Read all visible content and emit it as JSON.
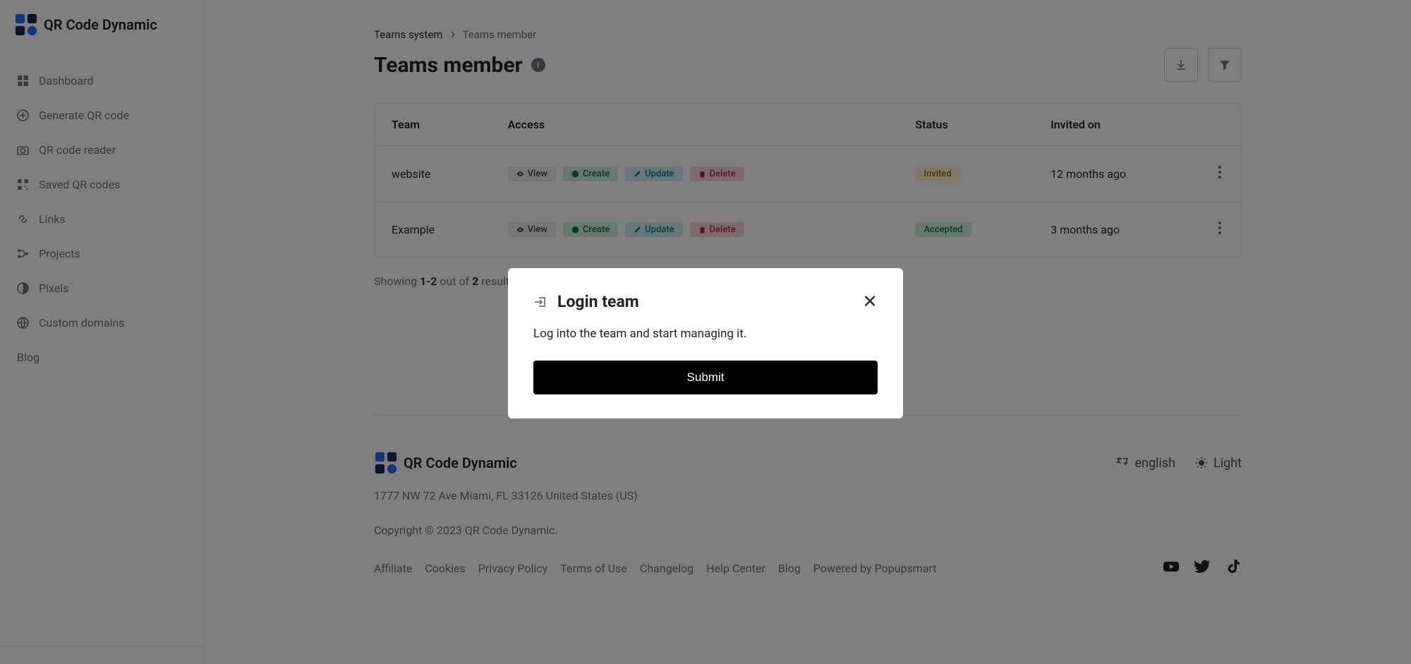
{
  "app": {
    "name": "QR Code Dynamic"
  },
  "sidebar": {
    "items": [
      {
        "label": "Dashboard"
      },
      {
        "label": "Generate QR code"
      },
      {
        "label": "QR code reader"
      },
      {
        "label": "Saved QR codes"
      },
      {
        "label": "Links"
      },
      {
        "label": "Projects"
      },
      {
        "label": "Pixels"
      },
      {
        "label": "Custom domains"
      },
      {
        "label": "Blog"
      }
    ]
  },
  "breadcrumb": {
    "root": "Teams system",
    "current": "Teams member"
  },
  "page": {
    "title": "Teams member"
  },
  "table": {
    "headers": {
      "team": "Team",
      "access": "Access",
      "status": "Status",
      "invited_on": "Invited on"
    },
    "rows": [
      {
        "team": "website",
        "access": {
          "view": "View",
          "create": "Create",
          "update": "Update",
          "delete": "Delete"
        },
        "status": "Invited",
        "status_kind": "invited",
        "invited_on": "12 months ago"
      },
      {
        "team": "Example",
        "access": {
          "view": "View",
          "create": "Create",
          "update": "Update",
          "delete": "Delete"
        },
        "status": "Accepted",
        "status_kind": "accepted",
        "invited_on": "3 months ago"
      }
    ]
  },
  "pager": {
    "prefix": "Showing ",
    "range": "1-2",
    "mid": " out of ",
    "total": "2",
    "suffix": " results."
  },
  "footer": {
    "address": "1777 NW 72 Ave Miami, FL 33126 United States (US)",
    "copyright": "Copyright © 2023 QR Code Dynamic.",
    "links": [
      "Affiliate",
      "Cookies",
      "Privacy Policy",
      "Terms of Use",
      "Changelog",
      "Help Center",
      "Blog",
      "Powered by Popupsmart"
    ],
    "language": "english",
    "theme": "Light"
  },
  "modal": {
    "title": "Login team",
    "body": "Log into the team and start managing it.",
    "submit": "Submit"
  }
}
